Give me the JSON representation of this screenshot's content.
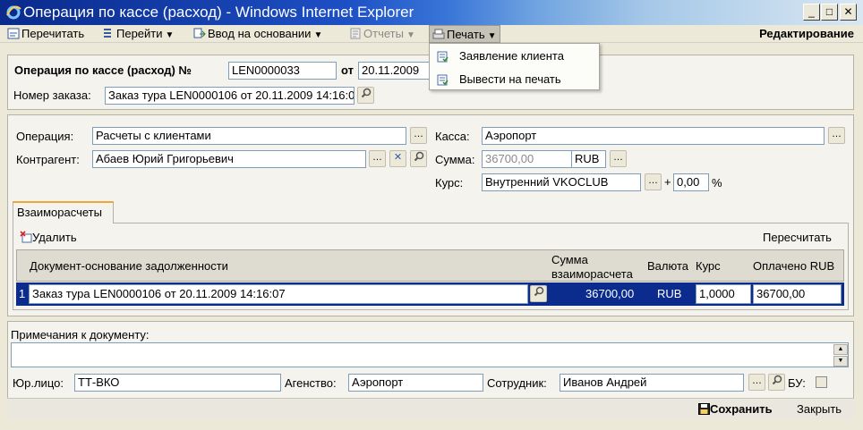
{
  "window": {
    "title": "Операция по кассе (расход) - Windows Internet Explorer",
    "btn_min": "_",
    "btn_max": "□",
    "btn_close": "✕"
  },
  "menu": {
    "reread": "Перечитать",
    "goto": "Перейти",
    "input_based": "Ввод на основании",
    "reports": "Отчеты",
    "print": "Печать",
    "mode": "Редактирование"
  },
  "print_menu": {
    "items": [
      "Заявление клиента",
      "Вывести на печать"
    ]
  },
  "header": {
    "doc_title_label": "Операция по кассе (расход) №",
    "doc_number": "LEN0000033",
    "from_label": "от",
    "doc_date": "20.11.2009",
    "order_label": "Номер заказа:",
    "order_value": "Заказ тура LEN0000106 от 20.11.2009 14:16:07"
  },
  "form": {
    "operation_label": "Операция:",
    "operation_value": "Расчеты с клиентами",
    "counterparty_label": "Контрагент:",
    "counterparty_value": "Абаев Юрий Григорьевич",
    "cash_label": "Касса:",
    "cash_value": "Аэропорт",
    "sum_label": "Сумма:",
    "sum_value": "36700,00",
    "sum_currency": "RUB",
    "rate_label": "Курс:",
    "rate_value": "Внутренний VKOCLUB",
    "plus": "+",
    "rate_percent": "0,00",
    "percent_sign": "%"
  },
  "tabs": {
    "settlements": "Взаиморасчеты"
  },
  "grid": {
    "delete_label": "Удалить",
    "recalc_label": "Пересчитать",
    "columns": {
      "doc": "Документ-основание задолженности",
      "sum_line1": "Сумма",
      "sum_line2": "взаиморасчета",
      "currency": "Валюта",
      "rate": "Курс",
      "paid": "Оплачено RUB"
    },
    "rows": [
      {
        "num": "1",
        "doc": "Заказ тура LEN0000106 от 20.11.2009 14:16:07",
        "sum": "36700,00",
        "currency": "RUB",
        "rate": "1,0000",
        "paid": "36700,00"
      }
    ]
  },
  "footer": {
    "notes_label": "Примечания к документу:",
    "notes_value": "",
    "legal_label": "Юр.лицо:",
    "legal_value": "ТТ-ВКО",
    "agency_label": "Агенство:",
    "agency_value": "Аэропорт",
    "employee_label": "Сотрудник:",
    "employee_value": "Иванов Андрей",
    "bu_label": "БУ:",
    "save_label": "Сохранить",
    "close_label": "Закрыть"
  },
  "colors": {
    "selected_row": "#0b2c8c",
    "title_gradient_start": "#0a2a8c",
    "tab_accent": "#f0a63a"
  },
  "icons": {
    "ie": "ie-logo-icon",
    "lookup": "magnifier-icon",
    "clear": "x-icon",
    "ellipsis": "ellipsis-icon",
    "save": "floppy-icon",
    "delete": "delete-row-icon",
    "print": "printer-icon"
  }
}
